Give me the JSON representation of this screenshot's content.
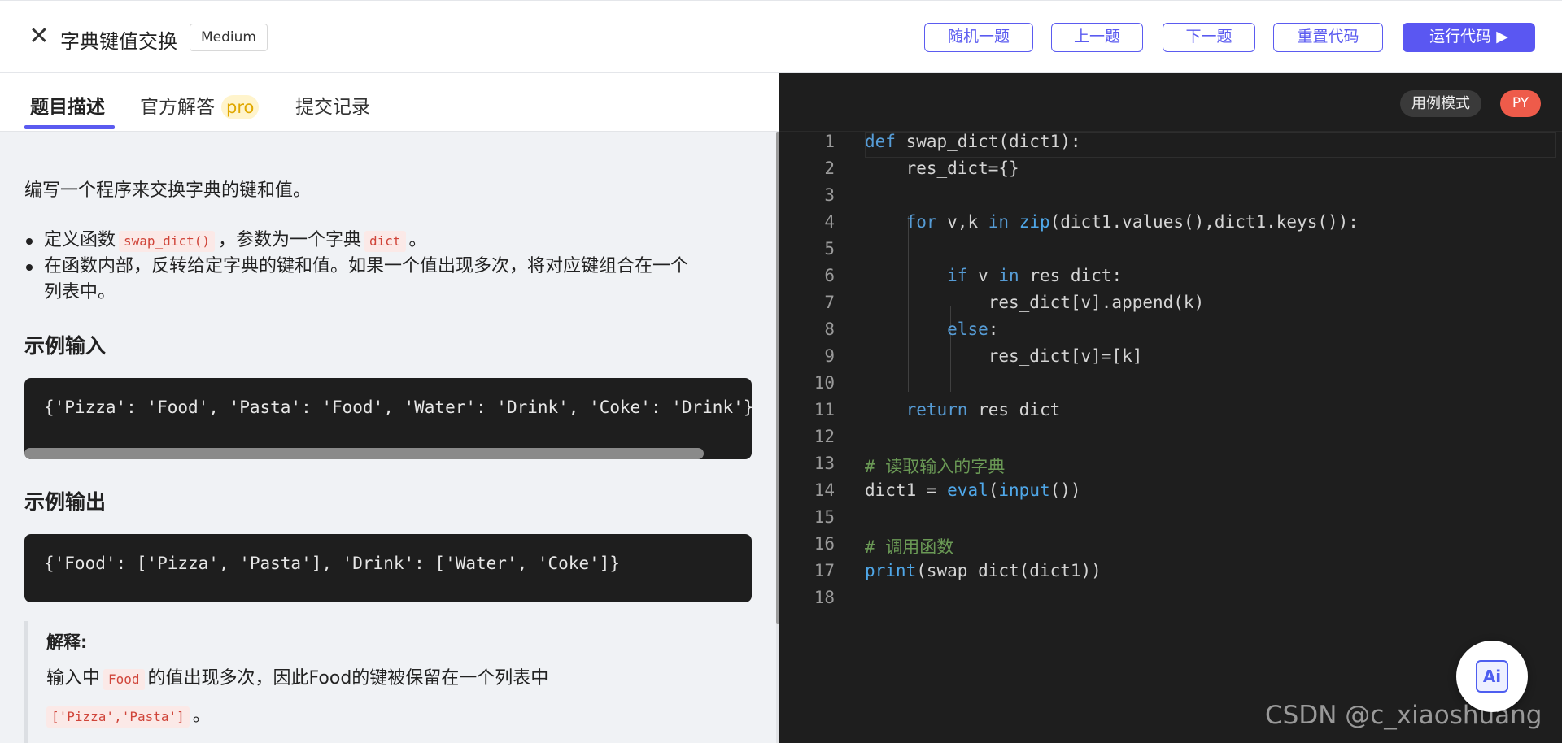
{
  "header": {
    "close_icon": "close-icon",
    "title": "字典键值交换",
    "difficulty": "Medium",
    "buttons": {
      "random": "随机一题",
      "prev": "上一题",
      "next": "下一题",
      "reset": "重置代码",
      "run": "运行代码 ▶"
    }
  },
  "tabs": {
    "description": "题目描述",
    "solution": "官方解答",
    "solution_badge": "pro",
    "submissions": "提交记录"
  },
  "problem": {
    "intro": "编写一个程序来交换字典的键和值。",
    "bullet1_prefix": "定义函数",
    "bullet1_code1": "swap_dict()",
    "bullet1_mid": "，参数为一个字典",
    "bullet1_code2": "dict",
    "bullet1_suffix": "。",
    "bullet2_line1": "在函数内部，反转给定字典的键和值。如果一个值出现多次，将对应键组合在一个",
    "bullet2_line2": "列表中。",
    "sample_input_heading": "示例输入",
    "sample_input": "{'Pizza': 'Food', 'Pasta': 'Food', 'Water': 'Drink', 'Coke': 'Drink'}",
    "sample_output_heading": "示例输出",
    "sample_output": "{'Food': ['Pizza', 'Pasta'], 'Drink': ['Water', 'Coke']}",
    "explain_title": "解释:",
    "explain_prefix": "输入中",
    "explain_code": "Food",
    "explain_rest": "的值出现多次，因此Food的键被保留在一个列表中",
    "explain_code2": "['Pizza','Pasta']",
    "explain_end": "。"
  },
  "editor": {
    "mode": "用例模式",
    "lang": "PY",
    "line_numbers": [
      "1",
      "2",
      "3",
      "4",
      "5",
      "6",
      "7",
      "8",
      "9",
      "10",
      "11",
      "12",
      "13",
      "14",
      "15",
      "16",
      "17",
      "18"
    ],
    "lines": [
      "def swap_dict(dict1):",
      "    res_dict={}",
      "",
      "    for v,k in zip(dict1.values(),dict1.keys()):",
      "",
      "        if v in res_dict:",
      "            res_dict[v].append(k)",
      "        else:",
      "            res_dict[v]=[k]",
      "",
      "    return res_dict",
      "",
      "# 读取输入的字典",
      "dict1 = eval(input())",
      "",
      "# 调用函数",
      "print(swap_dict(dict1))",
      ""
    ]
  },
  "ai_button": "Ai",
  "watermark": "CSDN @c_xiaoshuang"
}
